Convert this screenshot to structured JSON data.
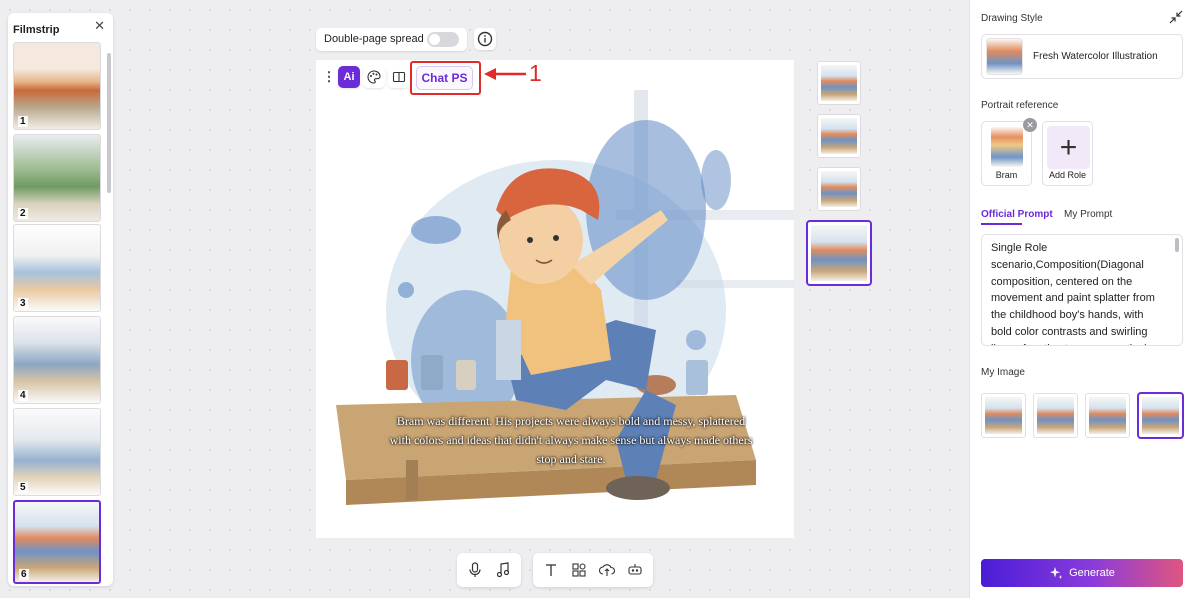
{
  "filmstrip": {
    "title": "Filmstrip",
    "close_icon": "close-icon",
    "pages": [
      {
        "number": "1",
        "scene": "autumn"
      },
      {
        "number": "2",
        "scene": "park"
      },
      {
        "number": "3",
        "scene": "kids"
      },
      {
        "number": "4",
        "scene": "girl"
      },
      {
        "number": "5",
        "scene": "girl2"
      },
      {
        "number": "6",
        "scene": "boy",
        "selected": true
      }
    ]
  },
  "top_toolbar": {
    "spread_label": "Double-page spread",
    "spread_enabled": false,
    "info_icon": "info-icon"
  },
  "image_toolbar": {
    "more_icon": "more-vertical-icon",
    "ai_label": "Ai",
    "palette_icon": "palette-icon",
    "book_icon": "book-icon",
    "chat_ps_label": "Chat PS",
    "annotation_number": "1"
  },
  "canvas": {
    "caption": "Bram was different. His projects were always bold and messy, splattered with colors and ideas that didn't always make sense but always made others stop and stare."
  },
  "variants": {
    "count": 4,
    "selected_index": 3
  },
  "bottom_toolbar": {
    "group1": [
      "microphone-icon",
      "music-icon"
    ],
    "group2": [
      "text-icon",
      "shapes-icon",
      "upload-icon",
      "effects-icon"
    ]
  },
  "panel": {
    "drawing_style_title": "Drawing Style",
    "style_name": "Fresh Watercolor Illustration",
    "portrait_title": "Portrait reference",
    "roles": [
      {
        "label": "Bram"
      }
    ],
    "add_role_label": "Add Role",
    "tabs": [
      {
        "label": "Official Prompt",
        "active": true
      },
      {
        "label": "My Prompt",
        "active": false
      }
    ],
    "prompt_text": "Single Role scenario,Composition(Diagonal composition, centered on the movement and paint splatter from the childhood boy's hands, with bold color contrasts and swirling lines of motion to convey action)",
    "my_image_title": "My Image",
    "my_images_selected": 3,
    "generate_label": "Generate"
  },
  "colors": {
    "accent": "#6b2bd9",
    "annotation": "#e12a2a"
  }
}
